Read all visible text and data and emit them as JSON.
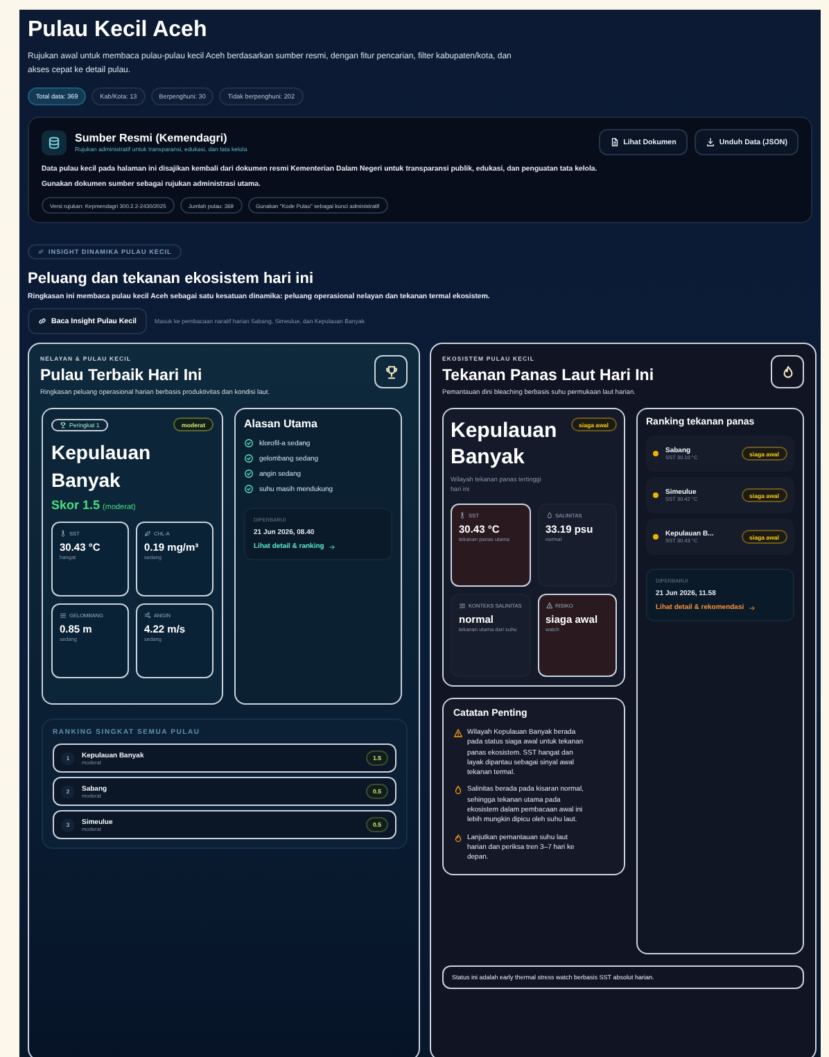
{
  "title": "Pulau Kecil Aceh",
  "description": "Rujukan awal untuk membaca pulau-pulau kecil Aceh berdasarkan sumber resmi, dengan fitur pencarian, filter kabupaten/kota, dan akses cepat ke detail pulau.",
  "stats": [
    {
      "label": "Total data: 369",
      "highlighted": true
    },
    {
      "label": "Kab/Kota: 13",
      "highlighted": false
    },
    {
      "label": "Berpenghuni: 30",
      "highlighted": false
    },
    {
      "label": "Tidak berpenghuni: 202",
      "highlighted": false
    }
  ],
  "source": {
    "title": "Sumber Resmi (Kemendagri)",
    "subtitle": "Rujukan administratif untuk transparansi, edukasi, dan tata kelola",
    "buttons": [
      {
        "label": "Lihat Dokumen",
        "kind": "file"
      },
      {
        "label": "Unduh Data (JSON)",
        "kind": "download"
      }
    ],
    "body": "Data pulau kecil pada halaman ini disajikan kembali dari dokumen resmi Kementerian Dalam Negeri untuk transparansi publik, edukasi, dan penguatan tata kelola. Gunakan dokumen sumber sebagai rujukan administrasi utama.",
    "tags": [
      "Versi rujukan: Kepmendagri 300.2.2-2430/2025",
      "Jumlah pulau: 369",
      "Gunakan \"Kode Pulau\" sebagai kunci administratif"
    ]
  },
  "insight": {
    "badge": "INSIGHT DINAMIKA PULAU KECIL",
    "heading": "Peluang dan tekanan ekosistem hari ini",
    "description": "Ringkasan ini membaca pulau kecil Aceh sebagai satu kesatuan dinamika: peluang operasional nelayan dan tekanan termal ekosistem.",
    "button": "Baca Insight Pulau Kecil",
    "hint": "Masuk ke pembacaan naratif harian Sabang, Simeulue, dan Kepulauan Banyak"
  },
  "fishing": {
    "eyebrow": "NELAYAN & PULAU KECIL",
    "title": "Pulau Terbaik Hari Ini",
    "description": "Ringkasan peluang operasional harian berbasis produktivitas dan kondisi laut.",
    "best": {
      "rank": "Peringkat 1",
      "status": "moderat",
      "name": "Kepulauan Banyak",
      "score": "Skor 1.5",
      "score_note": "(moderat)",
      "metrics": [
        {
          "kind": "temperature",
          "label": "SST",
          "value": "30.43 °C",
          "note": "hangat"
        },
        {
          "kind": "chlorophyll",
          "label": "CHL-A",
          "value": "0.19 mg/m³",
          "note": "sedang"
        },
        {
          "kind": "wave",
          "label": "GELOMBANG",
          "value": "0.85 m",
          "note": "sedang"
        },
        {
          "kind": "wind",
          "label": "ANGIN",
          "value": "4.22 m/s",
          "note": "sedang"
        }
      ]
    },
    "reasons": {
      "title": "Alasan Utama",
      "items": [
        "klorofil-a sedang",
        "gelombang sedang",
        "angin sedang",
        "suhu masih mendukung"
      ],
      "updated_label": "DIPERBARUI",
      "updated": "21 Jun 2026, 08.40",
      "link": "Lihat detail & ranking"
    },
    "ranking": {
      "title": "RANKING SINGKAT SEMUA PULAU",
      "items": [
        {
          "rank": "1",
          "name": "Kepulauan Banyak",
          "status": "moderat",
          "score": "1.5"
        },
        {
          "rank": "2",
          "name": "Sabang",
          "status": "moderat",
          "score": "0.5"
        },
        {
          "rank": "3",
          "name": "Simeulue",
          "status": "moderat",
          "score": "0.5"
        }
      ]
    }
  },
  "heat": {
    "eyebrow": "EKOSISTEM PULAU KECIL",
    "title": "Tekanan Panas Laut Hari Ini",
    "description": "Pemantauan dini bleaching berbasis suhu permukaan laut harian.",
    "top": {
      "name": "Kepulauan Banyak",
      "status": "siaga awal",
      "description": "Wilayah tekanan panas tertinggi hari ini",
      "metrics": [
        {
          "kind": "temperature",
          "label": "SST",
          "value": "30.43 °C",
          "note": "tekanan panas utama",
          "highlighted": true
        },
        {
          "kind": "salinity",
          "label": "SALINITAS",
          "value": "33.19 psu",
          "note": "normal",
          "highlighted": false
        },
        {
          "kind": "wave",
          "label": "KONTEKS SALINITAS",
          "value": "normal",
          "note": "tekanan utama dari suhu",
          "highlighted": false
        },
        {
          "kind": "risk",
          "label": "RISIKO",
          "value": "siaga awal",
          "note": "watch",
          "highlighted": true
        }
      ]
    },
    "ranking": {
      "title": "Ranking tekanan panas",
      "items": [
        {
          "name": "Sabang",
          "sst": "SST 30.10 °C",
          "status": "siaga awal",
          "color": "#eab308"
        },
        {
          "name": "Simeulue",
          "sst": "SST 30.42 °C",
          "status": "siaga awal",
          "color": "#eab308"
        },
        {
          "name": "Kepulauan B...",
          "sst": "SST 30.43 °C",
          "status": "siaga awal",
          "color": "#eab308"
        }
      ],
      "updated_label": "DIPERBARUI",
      "updated": "21 Jun 2026, 11.58",
      "link": "Lihat detail & rekomendasi"
    },
    "notes": {
      "title": "Catatan Penting",
      "items": [
        {
          "kind": "risk",
          "text": "Wilayah Kepulauan Banyak berada pada status siaga awal untuk tekanan panas ekosistem. SST hangat dan layak dipantau sebagai sinyal awal tekanan termal."
        },
        {
          "kind": "salinity",
          "text": "Salinitas berada pada kisaran normal, sehingga tekanan utama pada ekosistem dalam pembacaan awal ini lebih mungkin dipicu oleh suhu laut."
        },
        {
          "kind": "action",
          "text": "Lanjutkan pemantauan suhu laut harian dan periksa tren 3–7 hari ke depan."
        }
      ]
    },
    "footer": "Status ini adalah early thermal stress watch berbasis SST absolut harian."
  }
}
